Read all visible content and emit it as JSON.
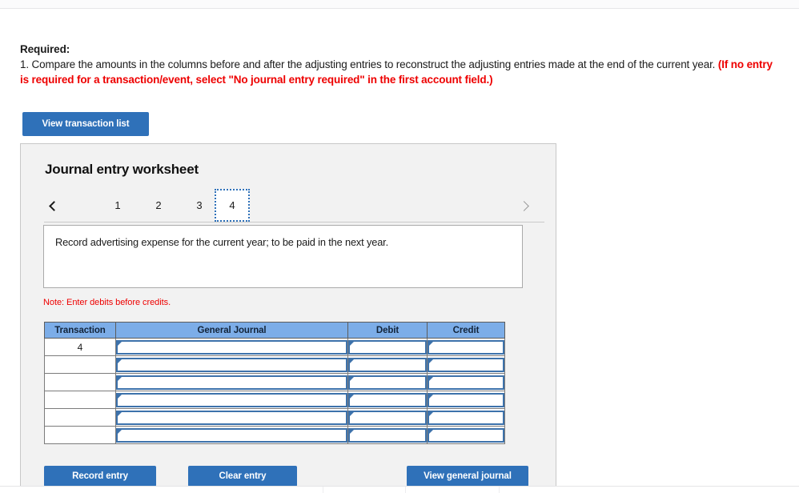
{
  "required": {
    "heading": "Required:",
    "line1": "1. Compare the amounts in the columns before and after the adjusting entries to reconstruct the adjusting entries made at the end of the current year.",
    "line1_red": "(If no entry is required for a transaction/event, select \"No journal entry required\" in the first account field.)"
  },
  "buttons": {
    "view_transaction_list": "View transaction list",
    "record_entry": "Record entry",
    "clear_entry": "Clear entry",
    "view_general_journal": "View general journal"
  },
  "worksheet": {
    "title": "Journal entry worksheet",
    "prev_arrow": "chevron-left",
    "next_arrow": "chevron-right",
    "tabs": [
      {
        "label": "1",
        "active": false
      },
      {
        "label": "2",
        "active": false
      },
      {
        "label": "3",
        "active": false
      },
      {
        "label": "4",
        "active": true
      }
    ],
    "description": "Record advertising expense for the current year; to be paid in the next year.",
    "note": "Note: Enter debits before credits."
  },
  "table": {
    "headers": [
      "Transaction",
      "General Journal",
      "Debit",
      "Credit"
    ],
    "rows": [
      {
        "transaction": "4",
        "general_journal": "",
        "debit": "",
        "credit": ""
      },
      {
        "transaction": "",
        "general_journal": "",
        "debit": "",
        "credit": ""
      },
      {
        "transaction": "",
        "general_journal": "",
        "debit": "",
        "credit": ""
      },
      {
        "transaction": "",
        "general_journal": "",
        "debit": "",
        "credit": ""
      },
      {
        "transaction": "",
        "general_journal": "",
        "debit": "",
        "credit": ""
      },
      {
        "transaction": "",
        "general_journal": "",
        "debit": "",
        "credit": ""
      }
    ]
  },
  "colors": {
    "button_blue": "#2f71b9",
    "table_header_blue": "#7cade8",
    "input_border_blue": "#3d72ab",
    "alert_red": "#ee0000",
    "panel_gray": "#f2f2f2"
  }
}
